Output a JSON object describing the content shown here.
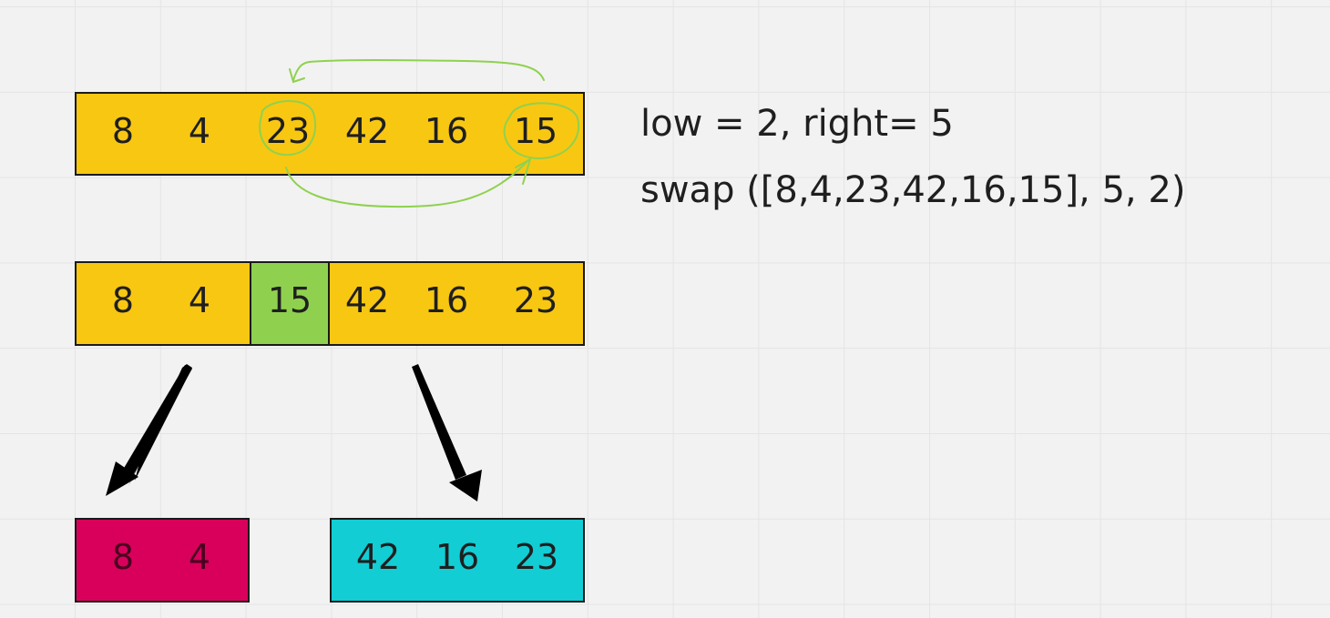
{
  "rows": {
    "initial": [
      "8",
      "4",
      "23",
      "42",
      "16",
      "15"
    ],
    "after_swap": {
      "left": [
        "8",
        "4"
      ],
      "pivot": "15",
      "right": [
        "42",
        "16",
        "23"
      ]
    },
    "left_partition": [
      "8",
      "4"
    ],
    "right_partition": [
      "42",
      "16",
      "23"
    ]
  },
  "notes": {
    "line1": "low = 2, right= 5",
    "line2": "swap ([8,4,23,42,16,15], 5, 2)"
  },
  "colors": {
    "yellow": "#f8c712",
    "pivot_green": "#8fd14f",
    "left_partition_magenta": "#d9005c",
    "right_partition_cyan": "#12cdd4",
    "annotation_green": "#8fd14f",
    "arrow_black": "#000000"
  }
}
